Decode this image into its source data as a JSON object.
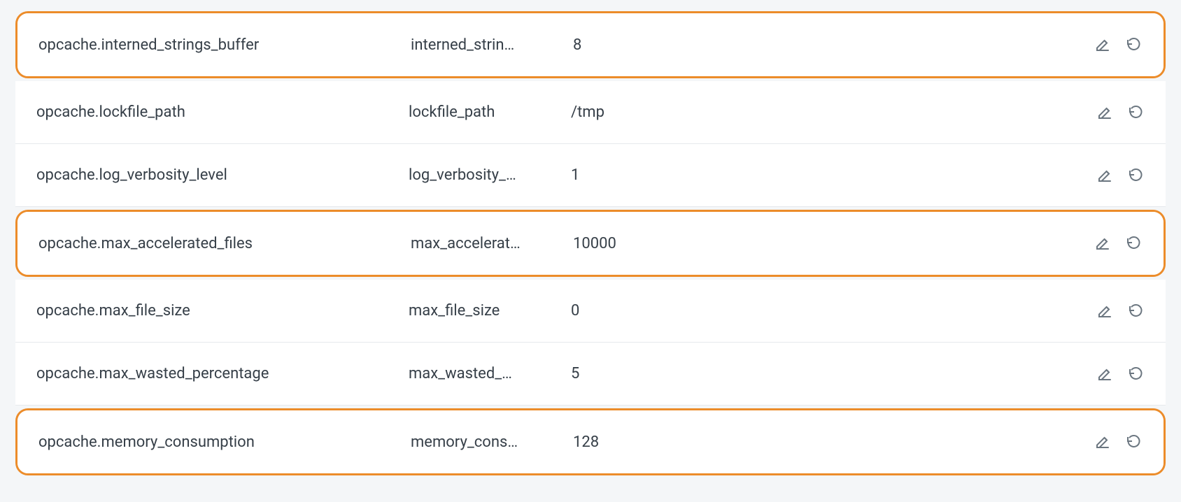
{
  "colors": {
    "highlight": "#ec8c2a"
  },
  "rows": [
    {
      "name": "opcache.interned_strings_buffer",
      "short": "interned_strin…",
      "value": "8",
      "highlight": true
    },
    {
      "name": "opcache.lockfile_path",
      "short": "lockfile_path",
      "value": "/tmp",
      "highlight": false
    },
    {
      "name": "opcache.log_verbosity_level",
      "short": "log_verbosity_…",
      "value": "1",
      "highlight": false
    },
    {
      "name": "opcache.max_accelerated_files",
      "short": "max_accelerat…",
      "value": "10000",
      "highlight": true
    },
    {
      "name": "opcache.max_file_size",
      "short": "max_file_size",
      "value": "0",
      "highlight": false
    },
    {
      "name": "opcache.max_wasted_percentage",
      "short": "max_wasted_…",
      "value": "5",
      "highlight": false
    },
    {
      "name": "opcache.memory_consumption",
      "short": "memory_cons…",
      "value": "128",
      "highlight": true
    }
  ]
}
